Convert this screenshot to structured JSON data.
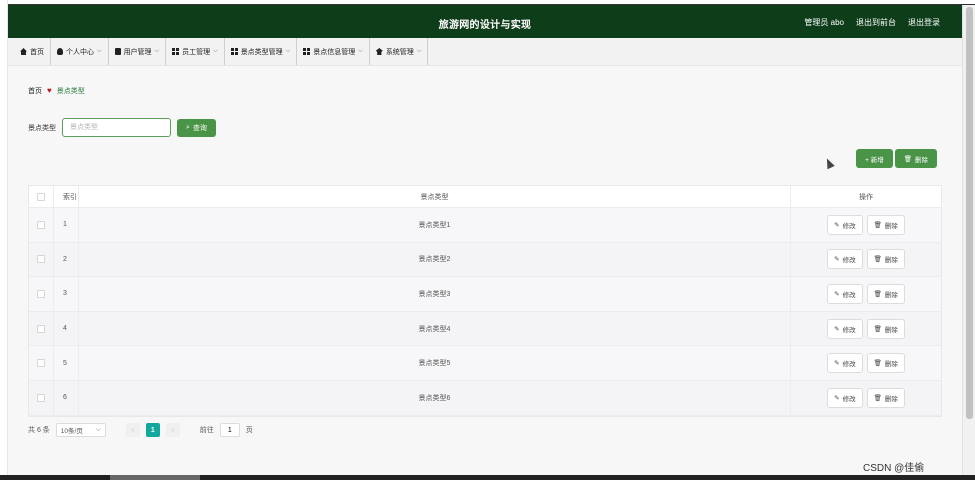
{
  "header": {
    "title": "旅游网的设计与实现",
    "admin": "管理员 abo",
    "back_front": "退出到前台",
    "logout": "退出登录"
  },
  "nav": {
    "items": [
      {
        "label": "首页",
        "icon": "home-icon",
        "has_dropdown": false
      },
      {
        "label": "个人中心",
        "icon": "user-icon",
        "has_dropdown": true
      },
      {
        "label": "用户管理",
        "icon": "bag-icon",
        "has_dropdown": true
      },
      {
        "label": "员工管理",
        "icon": "grid-icon",
        "has_dropdown": true
      },
      {
        "label": "景点类型管理",
        "icon": "grid-icon",
        "has_dropdown": true
      },
      {
        "label": "景点信息管理",
        "icon": "grid-icon",
        "has_dropdown": true
      },
      {
        "label": "系统管理",
        "icon": "cap-icon",
        "has_dropdown": true
      }
    ]
  },
  "breadcrumb": {
    "home": "首页",
    "current": "景点类型"
  },
  "search": {
    "label": "景点类型",
    "placeholder": "景点类型",
    "value": "",
    "query_label": "查询"
  },
  "actions": {
    "add_label": "+ 新增",
    "delete_label": "删除"
  },
  "table": {
    "headers": {
      "index": "索引",
      "type": "景点类型",
      "op": "操作"
    },
    "edit_label": "修改",
    "delete_label": "删除",
    "rows": [
      {
        "index": "1",
        "type": "景点类型1"
      },
      {
        "index": "2",
        "type": "景点类型2"
      },
      {
        "index": "3",
        "type": "景点类型3"
      },
      {
        "index": "4",
        "type": "景点类型4"
      },
      {
        "index": "5",
        "type": "景点类型5"
      },
      {
        "index": "6",
        "type": "景点类型6"
      }
    ]
  },
  "pager": {
    "total": "共 6 条",
    "page_size": "10条/页",
    "prev": "‹",
    "current_page": "1",
    "next": "›",
    "goto_label": "前往",
    "goto_value": "1",
    "page_unit": "页"
  },
  "watermark": "CSDN @佳偷",
  "colors": {
    "header_bg": "#0e3d1a",
    "primary_green": "#4a9448",
    "pager_active": "#13a89e",
    "heart_red": "#c0161b"
  }
}
